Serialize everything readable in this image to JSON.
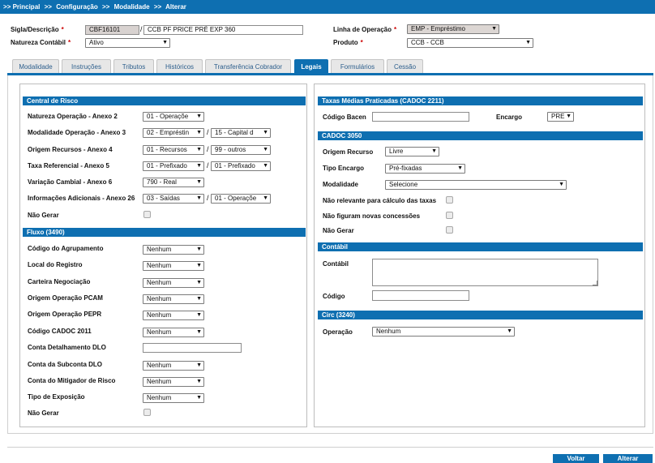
{
  "breadcrumb": {
    "items": [
      "Principal",
      "Configuração",
      "Modalidade",
      "Alterar"
    ],
    "separator": ">>",
    "prefix": ">>"
  },
  "header": {
    "sigla_label": "Sigla/Descrição",
    "sigla_value": "CBF16101",
    "descricao_value": "CCB PF PRICE PRÉ EXP 360",
    "natureza_label": "Natureza Contábil",
    "natureza_value": "Ativo",
    "linha_label": "Linha de Operação",
    "linha_value": "EMP - Empréstimo",
    "produto_label": "Produto",
    "produto_value": "CCB - CCB",
    "required_mark": "*"
  },
  "tabs": [
    {
      "label": "Modalidade",
      "active": false
    },
    {
      "label": "Instruções",
      "active": false
    },
    {
      "label": "Tributos",
      "active": false
    },
    {
      "label": "Históricos",
      "active": false
    },
    {
      "label": "Transferência Cobrador",
      "active": false
    },
    {
      "label": "Legais",
      "active": true
    },
    {
      "label": "Formulários",
      "active": false
    },
    {
      "label": "Cessão",
      "active": false
    }
  ],
  "central_risco": {
    "title": "Central de Risco",
    "natureza_label": "Natureza Operação - Anexo 2",
    "natureza_value": "01 - Operaçõe",
    "modalidade_label": "Modalidade Operação - Anexo 3",
    "modalidade_value1": "02 - Empréstin",
    "modalidade_value2": "15 - Capital d",
    "origem_label": "Origem Recursos - Anexo 4",
    "origem_value1": "01 - Recursos",
    "origem_value2": "99 - outros",
    "taxa_label": "Taxa Referencial - Anexo 5",
    "taxa_value1": "01 - Prefixado",
    "taxa_value2": "01 - Prefixado",
    "variacao_label": "Variação Cambial - Anexo 6",
    "variacao_value": "790 - Real",
    "info_label": "Informações Adicionais - Anexo 26",
    "info_value1": "03 - Saídas",
    "info_value2": "01 - Operaçõe",
    "nao_gerar_label": "Não Gerar"
  },
  "fluxo": {
    "title": "Fluxo (3490)",
    "agrupamento_label": "Código do Agrupamento",
    "agrupamento_value": "Nenhum",
    "local_label": "Local do Registro",
    "local_value": "Nenhum",
    "carteira_label": "Carteira Negociação",
    "carteira_value": "Nenhum",
    "pcam_label": "Origem Operação PCAM",
    "pcam_value": "Nenhum",
    "pepr_label": "Origem Operação PEPR",
    "pepr_value": "Nenhum",
    "cadoc_label": "Código CADOC 2011",
    "cadoc_value": "Nenhum",
    "detalhamento_label": "Conta Detalhamento DLO",
    "detalhamento_value": "",
    "subconta_label": "Conta da Subconta DLO",
    "subconta_value": "Nenhum",
    "mitigador_label": "Conta do Mitigador de Risco",
    "mitigador_value": "Nenhum",
    "exposicao_label": "Tipo de Exposição",
    "exposicao_value": "Nenhum",
    "nao_gerar_label": "Não Gerar"
  },
  "taxas_medias": {
    "title": "Taxas Médias Praticadas (CADOC 2211)",
    "codigo_label": "Código Bacen",
    "codigo_value": "",
    "encargo_label": "Encargo",
    "encargo_value": "PRE"
  },
  "cadoc3050": {
    "title": "CADOC 3050",
    "origem_label": "Origem Recurso",
    "origem_value": "Livre",
    "tipo_label": "Tipo Encargo",
    "tipo_value": "Pré-fixadas",
    "modalidade_label": "Modalidade",
    "modalidade_value": "Selecione",
    "nao_relevante_label": "Não relevante para cálculo das taxas",
    "nao_figuram_label": "Não figuram novas concessões",
    "nao_gerar_label": "Não Gerar"
  },
  "contabil": {
    "title": "Contábil",
    "contabil_label": "Contábil",
    "contabil_value": "",
    "codigo_label": "Código",
    "codigo_value": ""
  },
  "circ": {
    "title": "Circ (3240)",
    "operacao_label": "Operação",
    "operacao_value": "Nenhum"
  },
  "buttons": {
    "voltar": "Voltar",
    "alterar": "Alterar"
  },
  "colors": {
    "accent": "#0e6fb1",
    "required": "#cc0000",
    "readonly_field": "#d8d2d0"
  },
  "icons": {
    "select_arrow": "dropdown-arrow-icon",
    "textarea_resize": "resize-grip-icon"
  }
}
